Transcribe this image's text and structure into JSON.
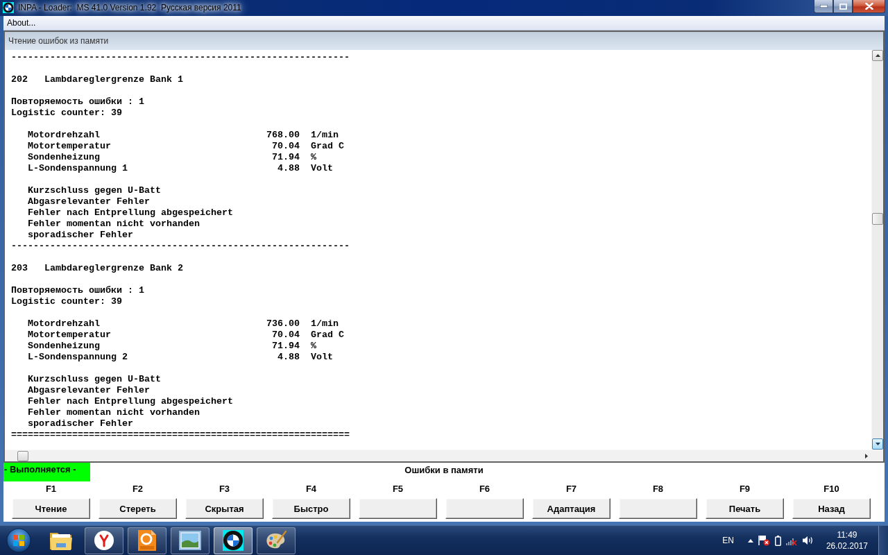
{
  "window": {
    "title": "INPA - Loader:  MS 41.0 Version 1.92  Русская версия 2011"
  },
  "menu": [
    {
      "label": "About..."
    }
  ],
  "panel": {
    "title": "Чтение ошибок из памяти"
  },
  "log": {
    "top_rule": "-------------------------------------------------------------",
    "faults": [
      {
        "code": "202",
        "title": "Lambdareglergrenze Bank 1",
        "details": [
          "Повторяемость ошибки : 1",
          "Logistic counter: 39"
        ],
        "parameters": [
          {
            "name": "Motordrehzahl",
            "value": "768.00",
            "unit": "1/min"
          },
          {
            "name": "Motortemperatur",
            "value": "70.04",
            "unit": "Grad C"
          },
          {
            "name": "Sondenheizung",
            "value": "71.94",
            "unit": "%"
          },
          {
            "name": "L-Sondenspannung 1",
            "value": "4.88",
            "unit": "Volt"
          }
        ],
        "flags": [
          "Kurzschluss gegen U-Batt",
          "Abgasrelevanter Fehler",
          "Fehler nach Entprellung abgespeichert",
          "Fehler momentan nicht vorhanden",
          "sporadischer Fehler"
        ],
        "rule": "-------------------------------------------------------------"
      },
      {
        "code": "203",
        "title": "Lambdareglergrenze Bank 2",
        "details": [
          "Повторяемость ошибки : 1",
          "Logistic counter: 39"
        ],
        "parameters": [
          {
            "name": "Motordrehzahl",
            "value": "736.00",
            "unit": "1/min"
          },
          {
            "name": "Motortemperatur",
            "value": "70.04",
            "unit": "Grad C"
          },
          {
            "name": "Sondenheizung",
            "value": "71.94",
            "unit": "%"
          },
          {
            "name": "L-Sondenspannung 2",
            "value": "4.88",
            "unit": "Volt"
          }
        ],
        "flags": [
          "Kurzschluss gegen U-Batt",
          "Abgasrelevanter Fehler",
          "Fehler nach Entprellung abgespeichert",
          "Fehler momentan nicht vorhanden",
          "sporadischer Fehler"
        ],
        "rule": "============================================================="
      }
    ]
  },
  "status": {
    "state": "- Выполняется -",
    "title": "Ошибки в памяти"
  },
  "function_keys": [
    {
      "key": "F1",
      "label": "Чтение"
    },
    {
      "key": "F2",
      "label": "Стереть"
    },
    {
      "key": "F3",
      "label": "Скрытая"
    },
    {
      "key": "F4",
      "label": "Быстро"
    },
    {
      "key": "F5"
    },
    {
      "key": "F6"
    },
    {
      "key": "F7",
      "label": "Адаптация"
    },
    {
      "key": "F8"
    },
    {
      "key": "F9",
      "label": "Печать"
    },
    {
      "key": "F10",
      "label": "Назад"
    }
  ],
  "taskbar": {
    "apps": [
      {
        "running": false,
        "selected": false
      },
      {
        "running": true,
        "selected": false
      },
      {
        "running": true,
        "selected": false
      },
      {
        "running": true,
        "selected": false
      },
      {
        "running": true,
        "selected": true
      },
      {
        "running": true,
        "selected": false
      }
    ],
    "language": "EN",
    "time": "11:49",
    "date": "26.02.2017"
  }
}
